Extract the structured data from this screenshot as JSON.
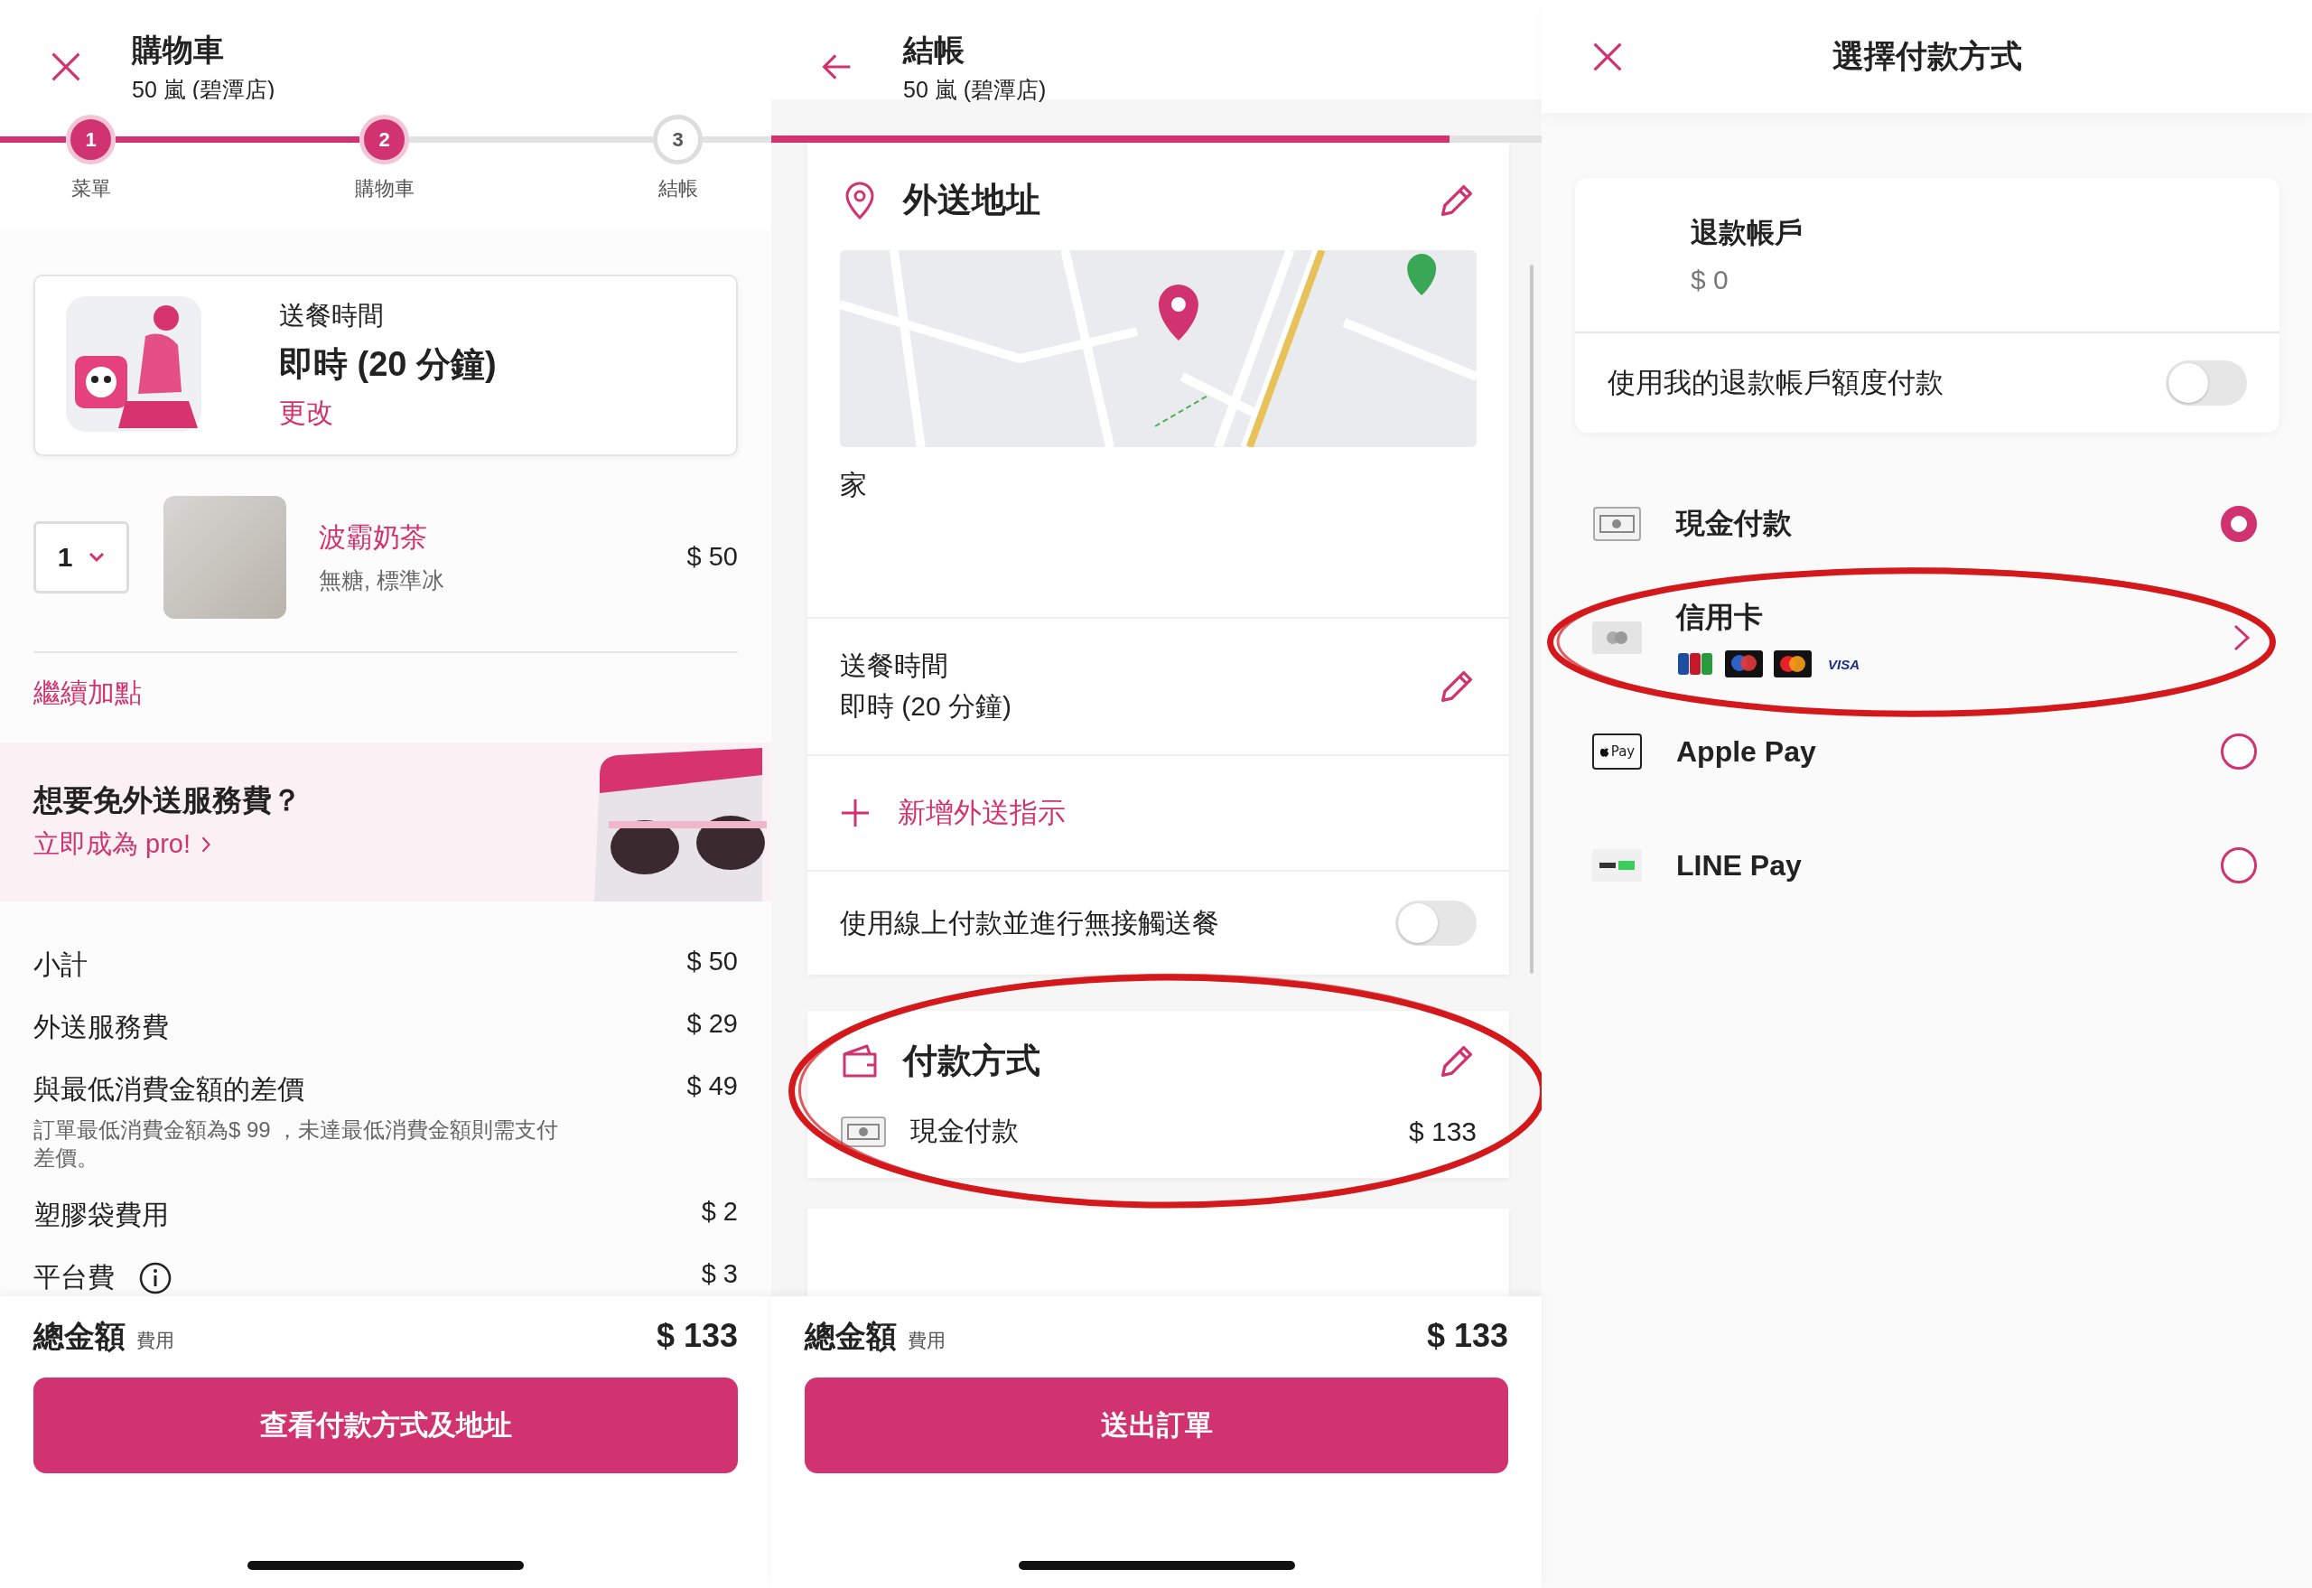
{
  "cart_screen": {
    "header": {
      "title": "購物車",
      "subtitle": "50 嵐 (碧潭店)"
    },
    "steps": [
      {
        "number": "1",
        "label": "菜單",
        "done": true
      },
      {
        "number": "2",
        "label": "購物車",
        "done": true
      },
      {
        "number": "3",
        "label": "結帳",
        "done": false
      }
    ],
    "delivery": {
      "label": "送餐時間",
      "value": "即時 (20 分鐘)",
      "link": "更改"
    },
    "item": {
      "quantity": "1",
      "name": "波霸奶茶",
      "options": "無糖, 標準冰",
      "price": "$ 50"
    },
    "add_more": "繼續加點",
    "promo": {
      "title": "想要免外送服務費？",
      "link": "立即成為 pro!"
    },
    "summary": [
      {
        "label": "小計",
        "value": "$ 50",
        "info_icon": false
      },
      {
        "label": "外送服務費",
        "value": "$ 29",
        "info_icon": false
      },
      {
        "label": "與最低消費金額的差價",
        "value": "$ 49",
        "note": "訂單最低消費金額為$ 99 ，未達最低消費金額則需支付差價。",
        "info_icon": false
      },
      {
        "label": "塑膠袋費用",
        "value": "$ 2",
        "info_icon": false
      },
      {
        "label": "平台費",
        "value": "$ 3",
        "info_icon": true
      }
    ],
    "footer": {
      "total_label": "總金額",
      "total_note": "費用",
      "total": "$ 133",
      "button": "查看付款方式及地址"
    }
  },
  "checkout_screen": {
    "header": {
      "title": "結帳",
      "subtitle": "50 嵐 (碧潭店)"
    },
    "progress": {
      "level": 0.88
    },
    "address": {
      "title": "外送地址",
      "label": "家"
    },
    "delivery_time": {
      "title": "送餐時間",
      "value": "即時 (20 分鐘)"
    },
    "instructions": "新增外送指示",
    "contactless": {
      "label": "使用線上付款並進行無接觸送餐",
      "on": false
    },
    "payment": {
      "title": "付款方式",
      "method": "現金付款",
      "amount": "$ 133",
      "highlighted": true
    },
    "footer": {
      "total_label": "總金額",
      "total_note": "費用",
      "total": "$ 133",
      "button": "送出訂單"
    }
  },
  "payment_screen": {
    "title": "選擇付款方式",
    "refund": {
      "title": "退款帳戶",
      "balance": "$ 0",
      "toggle_label": "使用我的退款帳戶額度付款",
      "on": false
    },
    "methods": [
      {
        "kind": "cash",
        "name": "現金付款",
        "opens_page": false,
        "selected": true,
        "highlighted": false
      },
      {
        "kind": "card",
        "name": "信用卡",
        "opens_page": true,
        "selected": false,
        "highlighted": true,
        "brands": [
          {
            "kind": "jcb"
          },
          {
            "kind": "maestro"
          },
          {
            "kind": "mastercard"
          },
          {
            "kind": "visa",
            "label": "VISA"
          }
        ]
      },
      {
        "kind": "applepay",
        "icon_text": "Pay",
        "name": "Apple Pay",
        "opens_page": false,
        "selected": false,
        "highlighted": false
      },
      {
        "kind": "linepay",
        "name": "LINE Pay",
        "opens_page": false,
        "selected": false,
        "highlighted": false
      }
    ]
  }
}
